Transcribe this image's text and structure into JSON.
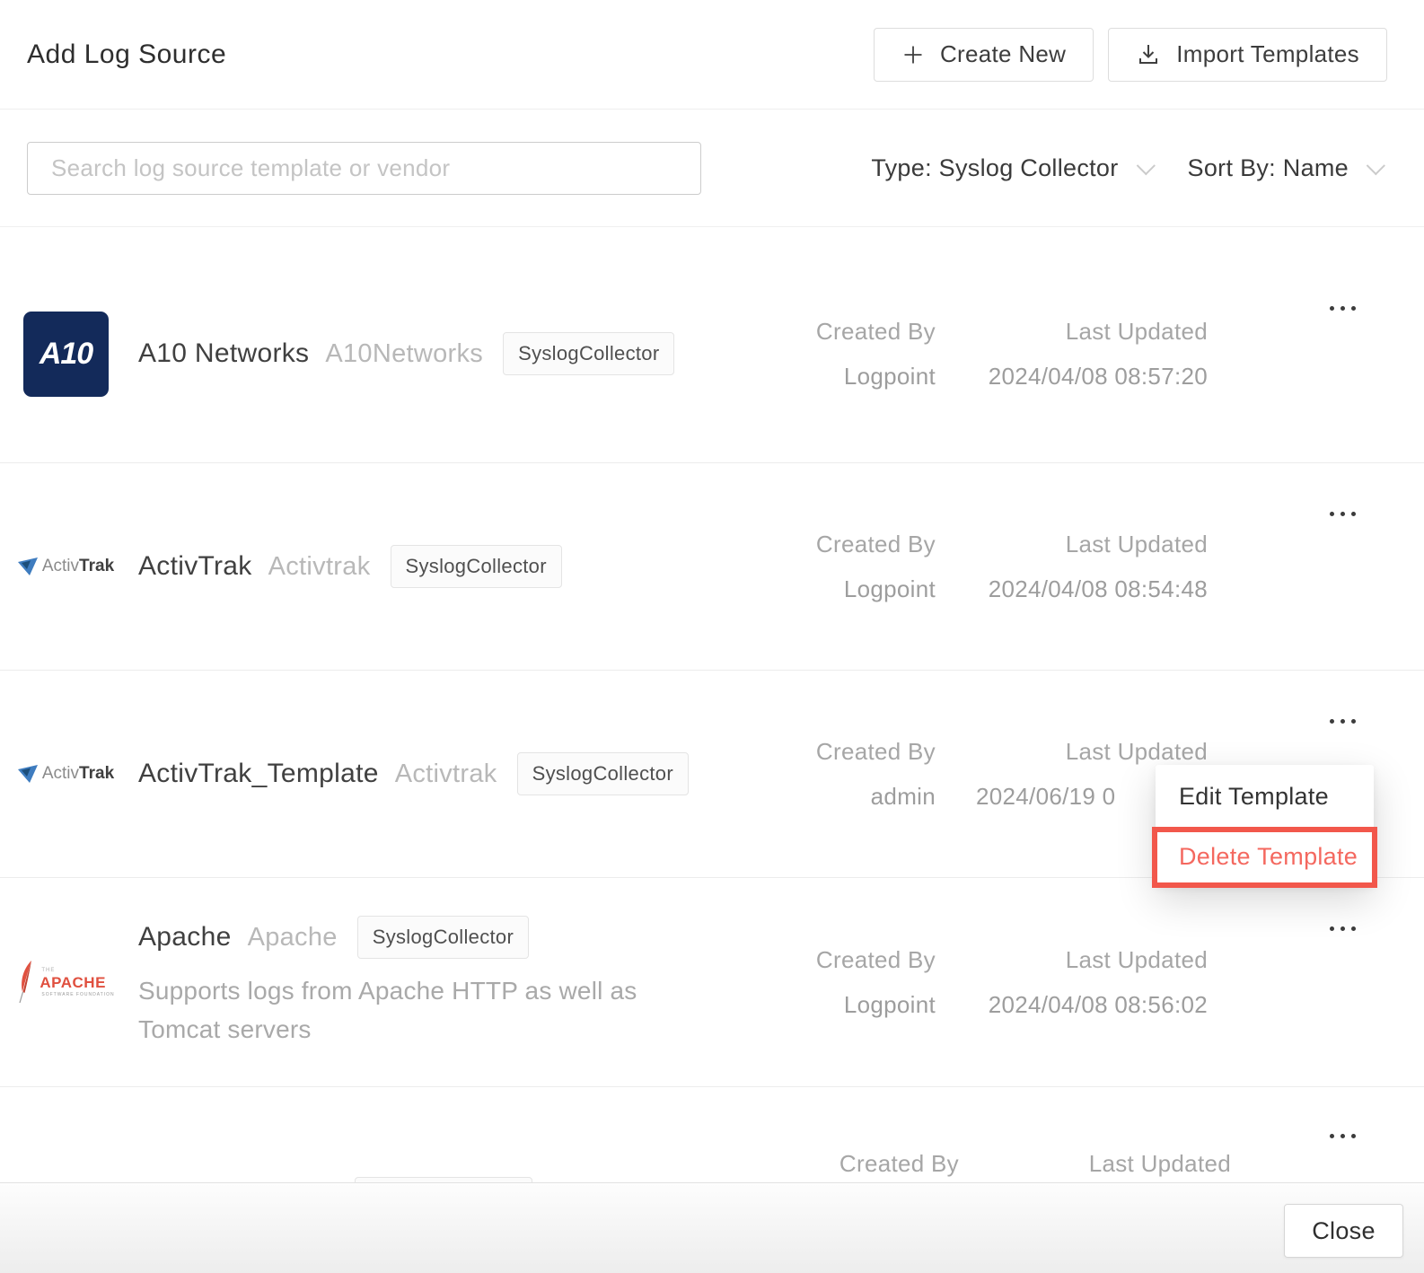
{
  "header": {
    "title": "Add Log Source",
    "create_new_label": "Create New",
    "import_templates_label": "Import Templates"
  },
  "filters": {
    "search_placeholder": "Search log source template or vendor",
    "type_label": "Type: Syslog Collector",
    "sort_label": "Sort By: Name"
  },
  "meta_labels": {
    "created_by": "Created By",
    "last_updated": "Last Updated"
  },
  "rows": [
    {
      "title": "A10 Networks",
      "vendor": "A10Networks",
      "badge": "SyslogCollector",
      "created_by": "Logpoint",
      "last_updated": "2024/04/08 08:57:20",
      "logo": "a10"
    },
    {
      "title": "ActivTrak",
      "vendor": "Activtrak",
      "badge": "SyslogCollector",
      "created_by": "Logpoint",
      "last_updated": "2024/04/08 08:54:48",
      "logo": "activtrak"
    },
    {
      "title": "ActivTrak_Template",
      "vendor": "Activtrak",
      "badge": "SyslogCollector",
      "created_by": "admin",
      "last_updated": "2024/06/19 0",
      "logo": "activtrak"
    },
    {
      "title": "Apache",
      "vendor": "Apache",
      "badge": "SyslogCollector",
      "description": "Supports logs from Apache HTTP as well as Tomcat servers",
      "created_by": "Logpoint",
      "last_updated": "2024/04/08 08:56:02",
      "logo": "apache"
    }
  ],
  "context_menu": {
    "edit_label": "Edit Template",
    "delete_label": "Delete Template"
  },
  "footer": {
    "close_label": "Close"
  },
  "logos": {
    "a10_text": "A10",
    "activtrak_gray": "Activ",
    "activtrak_bold": "Trak",
    "apache_the": "THE",
    "apache_name": "APACHE",
    "apache_sub": "SOFTWARE FOUNDATION"
  },
  "colors": {
    "delete_accent": "#f2574b",
    "delete_text": "#f4685f",
    "a10_navy": "#132a5a",
    "apache_red": "#e0503f",
    "activtrak_blue": "#3e7cbf"
  }
}
